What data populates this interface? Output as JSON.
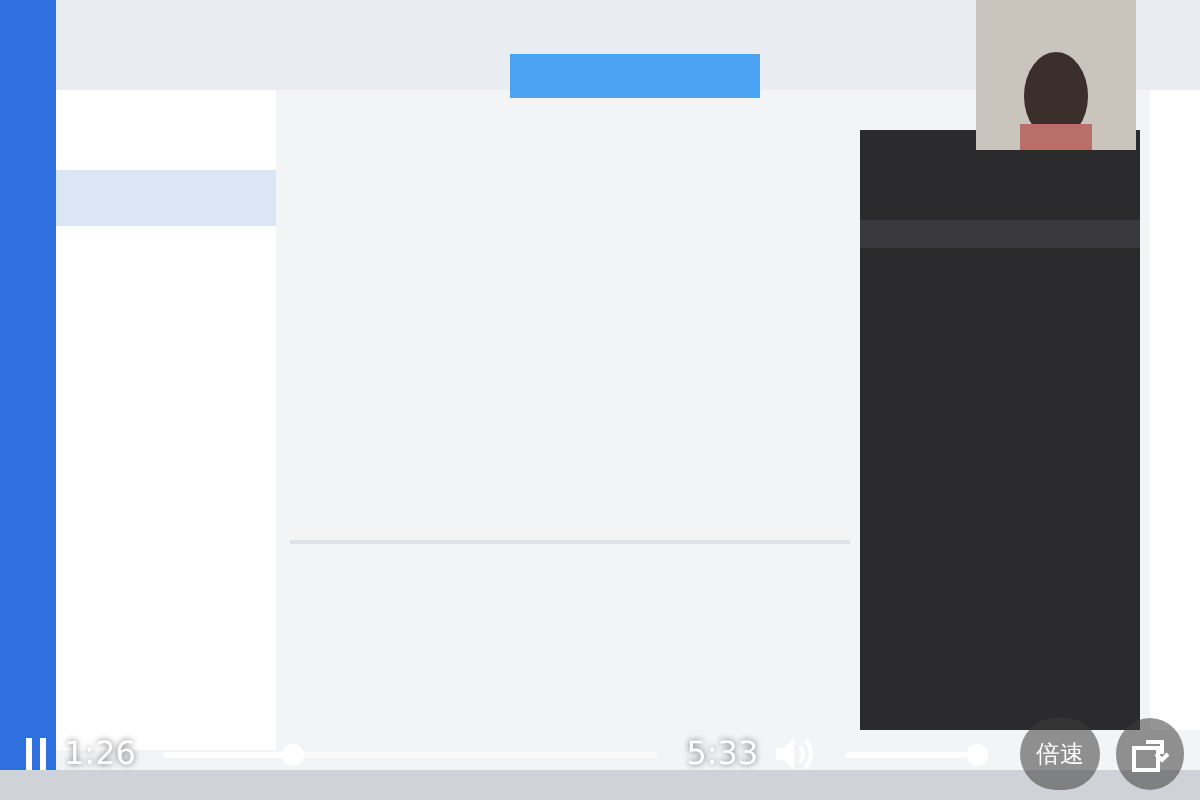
{
  "player": {
    "playing": true,
    "elapsed": "1:26",
    "duration": "5:33",
    "progress": {
      "level": 0.26
    },
    "volume": {
      "level": 1.0
    },
    "speed_button": "倍速"
  }
}
